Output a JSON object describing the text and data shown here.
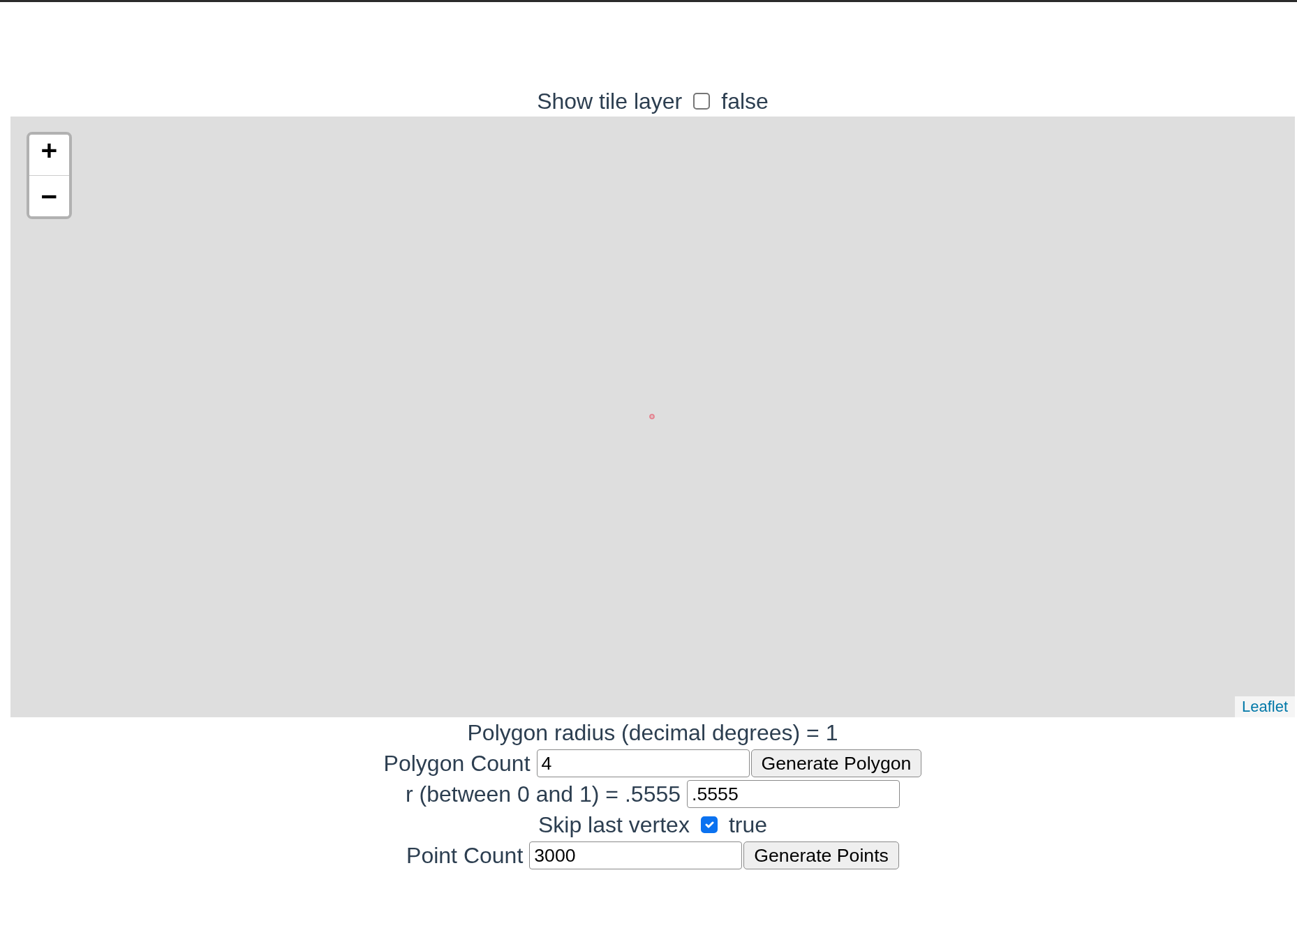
{
  "tile_toggle": {
    "label": "Show tile layer",
    "checked": false,
    "value_text": "false"
  },
  "map": {
    "zoom_controls": [
      "+",
      "−"
    ],
    "attribution": "Leaflet"
  },
  "controls": [
    {
      "kind": "text",
      "text": "Polygon radius (decimal degrees) = 1"
    },
    {
      "kind": "input",
      "label": "Polygon Count",
      "value": "4",
      "button": "Generate Polygon"
    },
    {
      "kind": "input",
      "label": "r (between 0 and 1) = .5555",
      "value": ".5555"
    },
    {
      "kind": "checkbox",
      "label": "Skip last vertex",
      "checked": true,
      "value_text": "true"
    },
    {
      "kind": "input",
      "label": "Point Count",
      "value": "3000",
      "button": "Generate Points"
    }
  ]
}
